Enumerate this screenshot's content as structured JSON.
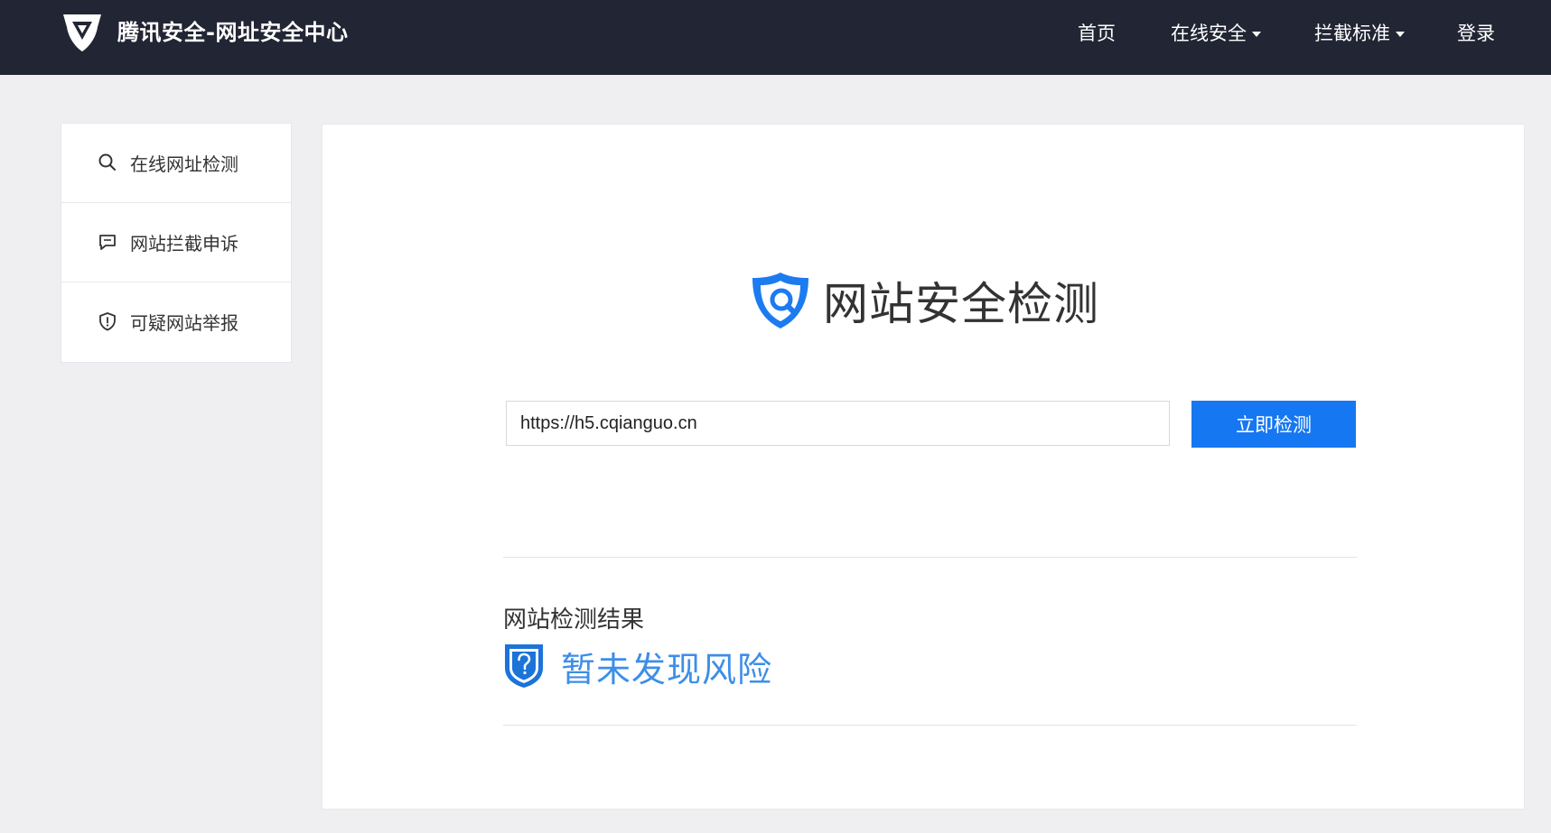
{
  "header": {
    "brand": "腾讯安全-网址安全中心",
    "nav": [
      {
        "label": "首页"
      },
      {
        "label": "在线安全"
      },
      {
        "label": "拦截标准"
      },
      {
        "label": "登录"
      }
    ]
  },
  "sidebar": {
    "items": [
      {
        "label": "在线网址检测",
        "icon": "search-icon"
      },
      {
        "label": "网站拦截申诉",
        "icon": "comment-icon"
      },
      {
        "label": "可疑网站举报",
        "icon": "shield-alert-icon"
      }
    ]
  },
  "main": {
    "title": "网站安全检测",
    "url_input": {
      "value": "https://h5.cqianguo.cn"
    },
    "check_button": "立即检测",
    "result": {
      "heading": "网站检测结果",
      "status": "暂未发现风险"
    }
  },
  "colors": {
    "header_bg": "#222533",
    "page_bg": "#efeff2",
    "primary": "#1677f2",
    "result_text": "#3d8ee8"
  }
}
